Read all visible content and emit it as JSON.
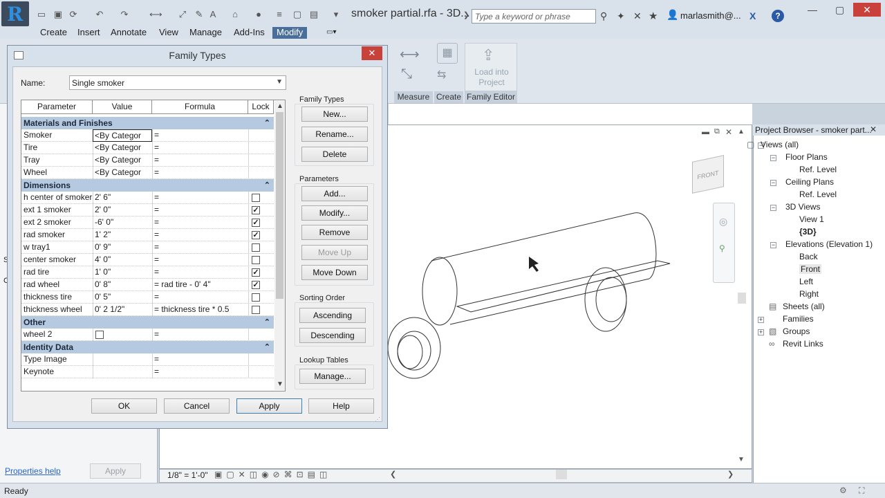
{
  "app": {
    "doc_title": "smoker partial.rfa - 3D...",
    "search_placeholder": "Type a keyword or phrase",
    "user": "marlasmith@...",
    "app_icon": "R"
  },
  "ribbon_tabs": [
    "Create",
    "Insert",
    "Annotate",
    "View",
    "Manage",
    "Add-Ins",
    "Modify"
  ],
  "ribbon": {
    "panels": [
      "Measure",
      "Create",
      "Family Editor"
    ],
    "load_into_project": "Load into Project"
  },
  "left_pane": {
    "properties_help": "Properties help",
    "apply": "Apply"
  },
  "view": {
    "scale": "1/8\" = 1'-0\"",
    "viewcube_label": "FRONT"
  },
  "project_browser": {
    "title": "Project Browser - smoker part...",
    "items": [
      {
        "label": "Views (all)"
      },
      {
        "label": "Floor Plans"
      },
      {
        "label": "Ref. Level"
      },
      {
        "label": "Ceiling Plans"
      },
      {
        "label": "Ref. Level"
      },
      {
        "label": "3D Views"
      },
      {
        "label": "View 1"
      },
      {
        "label": "{3D}"
      },
      {
        "label": "Elevations (Elevation 1)"
      },
      {
        "label": "Back"
      },
      {
        "label": "Front"
      },
      {
        "label": "Left"
      },
      {
        "label": "Right"
      },
      {
        "label": "Sheets (all)"
      },
      {
        "label": "Families"
      },
      {
        "label": "Groups"
      },
      {
        "label": "Revit Links"
      }
    ]
  },
  "status": "Ready",
  "dialog": {
    "title": "Family Types",
    "name_label": "Name:",
    "name_value": "Single smoker",
    "columns": [
      "Parameter",
      "Value",
      "Formula",
      "Lock"
    ],
    "groups": [
      {
        "name": "Materials and Finishes",
        "rows": [
          {
            "param": "Smoker",
            "value": "<By Categor",
            "formula": "=",
            "lock": null
          },
          {
            "param": "Tire",
            "value": "<By Categor",
            "formula": "=",
            "lock": null
          },
          {
            "param": "Tray",
            "value": "<By Categor",
            "formula": "=",
            "lock": null
          },
          {
            "param": "Wheel",
            "value": "<By Categor",
            "formula": "=",
            "lock": null
          }
        ]
      },
      {
        "name": "Dimensions",
        "rows": [
          {
            "param": "h center of smoker",
            "value": "2'  6\"",
            "formula": "=",
            "lock": false
          },
          {
            "param": "ext 1 smoker",
            "value": "2'  0\"",
            "formula": "=",
            "lock": true
          },
          {
            "param": "ext 2 smoker",
            "value": "-6'  0\"",
            "formula": "=",
            "lock": true
          },
          {
            "param": "rad smoker",
            "value": "1'  2\"",
            "formula": "=",
            "lock": true
          },
          {
            "param": "w tray1",
            "value": "0'  9\"",
            "formula": "=",
            "lock": false
          },
          {
            "param": "center smoker",
            "value": "4'  0\"",
            "formula": "=",
            "lock": false
          },
          {
            "param": "rad tire",
            "value": "1'  0\"",
            "formula": "=",
            "lock": true
          },
          {
            "param": "rad wheel",
            "value": "0'  8\"",
            "formula": "= rad tire - 0'  4\"",
            "lock": true
          },
          {
            "param": "thickness tire",
            "value": "0'  5\"",
            "formula": "=",
            "lock": false
          },
          {
            "param": "thickness wheel",
            "value": "0'  2 1/2\"",
            "formula": "= thickness tire * 0.5",
            "lock": false
          }
        ]
      },
      {
        "name": "Other",
        "rows": [
          {
            "param": "wheel 2",
            "value": "",
            "formula": "=",
            "lock": null
          }
        ]
      },
      {
        "name": "Identity Data",
        "rows": [
          {
            "param": "Type Image",
            "value": "",
            "formula": "=",
            "lock": null
          },
          {
            "param": "Keynote",
            "value": "",
            "formula": "=",
            "lock": null
          }
        ]
      }
    ],
    "family_types": {
      "label": "Family Types",
      "new": "New...",
      "rename": "Rename...",
      "delete": "Delete"
    },
    "parameters": {
      "label": "Parameters",
      "add": "Add...",
      "modify": "Modify...",
      "remove": "Remove",
      "move_up": "Move Up",
      "move_down": "Move Down"
    },
    "sorting": {
      "label": "Sorting Order",
      "ascending": "Ascending",
      "descending": "Descending"
    },
    "lookup": {
      "label": "Lookup Tables",
      "manage": "Manage..."
    },
    "footer": {
      "ok": "OK",
      "cancel": "Cancel",
      "apply": "Apply",
      "help": "Help"
    }
  }
}
